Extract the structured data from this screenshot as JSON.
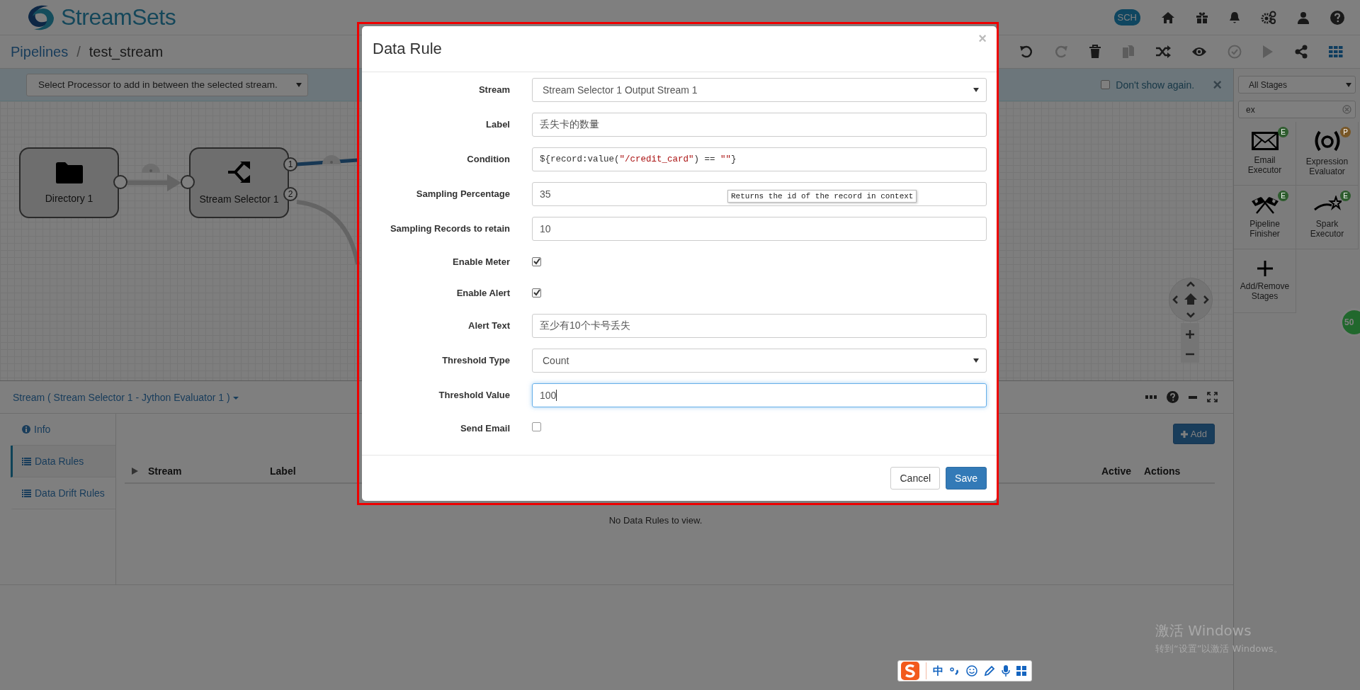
{
  "header": {
    "logo_text": "StreamSets",
    "cloud_badge": "SCH"
  },
  "breadcrumb": {
    "parent": "Pipelines",
    "separator": "/",
    "current": "test_stream"
  },
  "info_bar": {
    "processor_select": "Select Processor to add in between the selected stream.",
    "dont_show": {
      "label": "Don't show again.",
      "checked": false
    },
    "close": "×"
  },
  "canvas": {
    "nodes": [
      {
        "label": "Directory 1",
        "kind": "origin"
      },
      {
        "label": "Stream Selector 1",
        "kind": "selector",
        "outputs": [
          "1",
          "2"
        ]
      }
    ]
  },
  "stage_library": {
    "filter": "All Stages",
    "search": "ex",
    "stages": [
      {
        "name": "Email Executor",
        "kind": "email",
        "badge": "E",
        "color": "#2e5c2e"
      },
      {
        "name": "Expression Evaluator",
        "kind": "expression",
        "badge": "P",
        "color": "#785727"
      },
      {
        "name": "Pipeline Finisher",
        "kind": "flags",
        "badge": "E",
        "color": "#2e5c2e"
      },
      {
        "name": "Spark Executor",
        "kind": "spark",
        "badge": "E",
        "color": "#2e5c2e"
      }
    ],
    "add_remove": "Add/Remove Stages"
  },
  "floating_badge": "50",
  "bottom_panel": {
    "title": "Stream ( Stream Selector 1 - Jython Evaluator 1 )",
    "tabs": [
      {
        "label": "Info",
        "kind": "info",
        "selected": false
      },
      {
        "label": "Data Rules",
        "kind": "list",
        "selected": true
      },
      {
        "label": "Data Drift Rules",
        "kind": "list",
        "selected": false
      }
    ],
    "add_button": "Add",
    "columns": [
      "Stream",
      "Label",
      "Active",
      "Actions"
    ],
    "empty": "No Data Rules to view."
  },
  "dialog": {
    "title": "Data Rule",
    "close": "×",
    "fields": [
      {
        "kind": "select",
        "label": "Stream",
        "value": "Stream Selector 1 Output Stream 1",
        "focused": false
      },
      {
        "kind": "text",
        "label": "Label",
        "value": "丢失卡的数量",
        "focused": false
      },
      {
        "kind": "code",
        "label": "Condition",
        "focused": false,
        "tokens": [
          {
            "kind": "plain",
            "text": "${record:value("
          },
          {
            "kind": "string",
            "text": "\"/credit_card\""
          },
          {
            "kind": "plain",
            "text": ") == "
          },
          {
            "kind": "string",
            "text": "\"\""
          },
          {
            "kind": "plain",
            "text": "}"
          }
        ]
      },
      {
        "kind": "text",
        "label": "Sampling Percentage",
        "value": "35",
        "focused": false
      },
      {
        "kind": "text",
        "label": "Sampling Records to retain",
        "value": "10",
        "focused": false
      },
      {
        "kind": "checkbox",
        "label": "Enable Meter",
        "checked": true
      },
      {
        "kind": "checkbox",
        "label": "Enable Alert",
        "checked": true
      },
      {
        "kind": "text",
        "label": "Alert Text",
        "value": "至少有10个卡号丢失",
        "focused": false
      },
      {
        "kind": "select",
        "label": "Threshold Type",
        "value": "Count",
        "focused": false
      },
      {
        "kind": "text",
        "label": "Threshold Value",
        "value": "100",
        "focused": true
      },
      {
        "kind": "checkbox",
        "label": "Send Email",
        "checked": false
      }
    ],
    "tooltip": "Returns the id of the record in context",
    "buttons": [
      {
        "label": "Cancel",
        "kind": "default"
      },
      {
        "label": "Save",
        "kind": "primary"
      }
    ]
  },
  "ime_bar": {
    "mode": "中"
  },
  "os_notice": {
    "title": "激活 Windows",
    "text": "转到“设置”以激活 Windows。"
  }
}
